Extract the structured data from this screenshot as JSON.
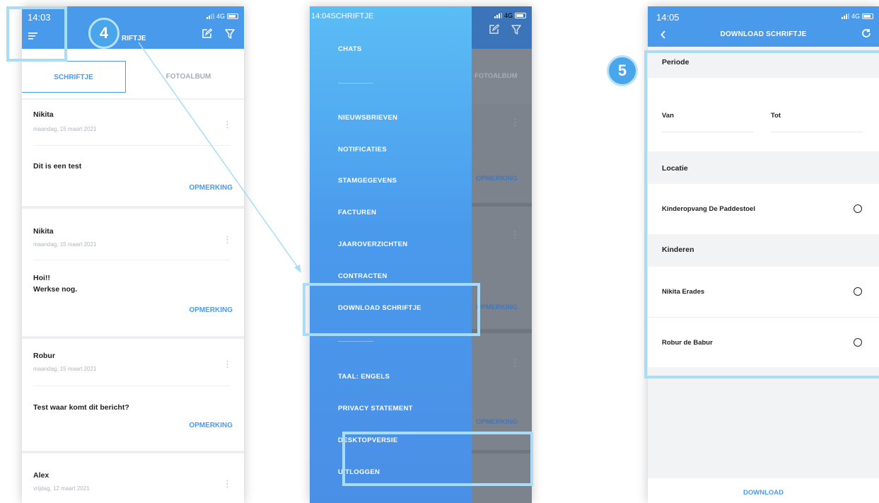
{
  "colors": {
    "accent": "#4a9aec",
    "highlight": "#a9dcf6",
    "badge": "#4aa6ea"
  },
  "status_bar": {
    "network": "4G"
  },
  "panel1": {
    "time": "14:03",
    "title_partial": "RIFTJE",
    "tabs": {
      "active": "SCHRIFTJE",
      "inactive": "FOTOALBUM"
    },
    "posts": [
      {
        "name": "Nikita",
        "date": "maandag, 15 maart 2021",
        "message": "Dit is een test",
        "action": "OPMERKING"
      },
      {
        "name": "Nikita",
        "date": "maandag, 15 maart 2021",
        "message_line1": "Hoi!!",
        "message_line2": "Werkse nog.",
        "action": "OPMERKING"
      },
      {
        "name": "Robur",
        "date": "maandag, 15 maart 2021",
        "message": "Test waar komt dit bericht?",
        "action": "OPMERKING"
      },
      {
        "name": "Alex",
        "date": "vrijdag, 12 maart 2021"
      }
    ]
  },
  "panel2": {
    "time_title": "14:04SCHRIFTJE",
    "menu": {
      "chats": "CHATS",
      "nieuwsbrieven": "NIEUWSBRIEVEN",
      "notificaties": "NOTIFICATIES",
      "stamgegevens": "STAMGEGEVENS",
      "facturen": "FACTUREN",
      "jaaroverzichten": "JAAROVERZICHTEN",
      "contracten": "CONTRACTEN",
      "download": "DOWNLOAD SCHRIFTJE",
      "taal": "TAAL: ENGELS",
      "privacy": "PRIVACY STATEMENT",
      "desktop": "DESKTOPVERSIE",
      "uitloggen": "UITLOGGEN"
    },
    "background": {
      "tab": "FOTOALBUM",
      "action": "OPMERKING"
    }
  },
  "panel3": {
    "time": "14:05",
    "title": "DOWNLOAD SCHRIFTJE",
    "periode": {
      "heading": "Periode",
      "van": "Van",
      "tot": "Tot"
    },
    "locatie": {
      "heading": "Locatie",
      "option": "Kinderopvang De Paddestoel"
    },
    "kinderen": {
      "heading": "Kinderen",
      "children": [
        "Nikita Erades",
        "Robur de Babur"
      ]
    },
    "download_button": "DOWNLOAD"
  },
  "annotations": {
    "step4": "4",
    "step5": "5"
  }
}
